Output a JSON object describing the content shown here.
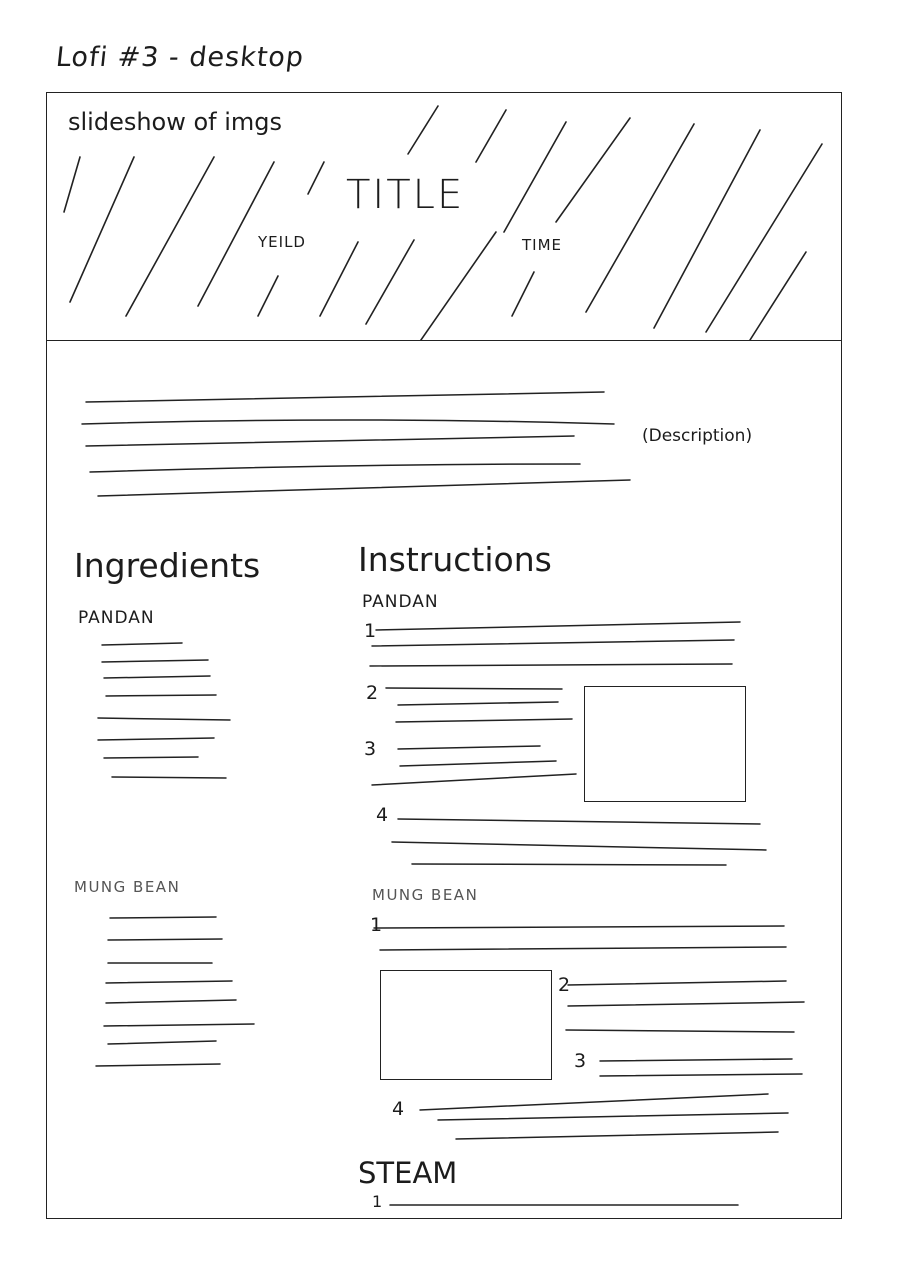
{
  "sketch": {
    "heading": "Lofi #3 - desktop",
    "hero": {
      "label": "slideshow of imgs",
      "title": "TITLE",
      "yield": "YEILD",
      "time": "TIME"
    },
    "description": {
      "note": "(Description)"
    },
    "ingredients": {
      "heading": "Ingredients",
      "groups": [
        {
          "name": "PANDAN"
        },
        {
          "name": "MUNG BEAN"
        }
      ]
    },
    "instructions": {
      "heading": "Instructions",
      "groups": [
        {
          "name": "PANDAN",
          "steps": [
            "1",
            "2",
            "3",
            "4"
          ]
        },
        {
          "name": "MUNG BEAN",
          "steps": [
            "1",
            "2",
            "3",
            "4"
          ]
        },
        {
          "name": "STEAM",
          "steps": [
            "1"
          ]
        }
      ]
    }
  }
}
